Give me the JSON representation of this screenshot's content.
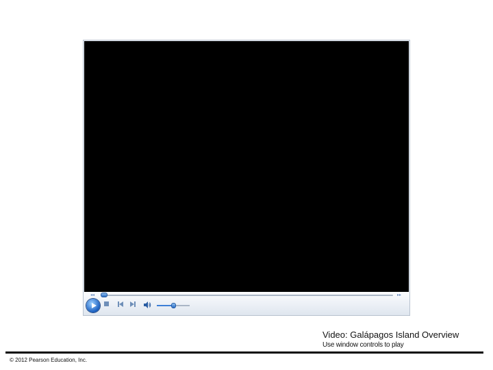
{
  "player": {
    "progress_fraction": 0.01,
    "volume_fraction": 0.5,
    "seek_back_glyph": "◂◂",
    "seek_fwd_glyph": "▸▸",
    "icons": [
      "play-icon",
      "stop-icon",
      "previous-icon",
      "next-icon",
      "volume-icon"
    ],
    "accent_color": "#2a6cc4"
  },
  "caption": {
    "title": "Video: Galápagos Island Overview",
    "subtitle": "Use window controls to play"
  },
  "footer": {
    "copyright": "© 2012 Pearson Education, Inc."
  }
}
